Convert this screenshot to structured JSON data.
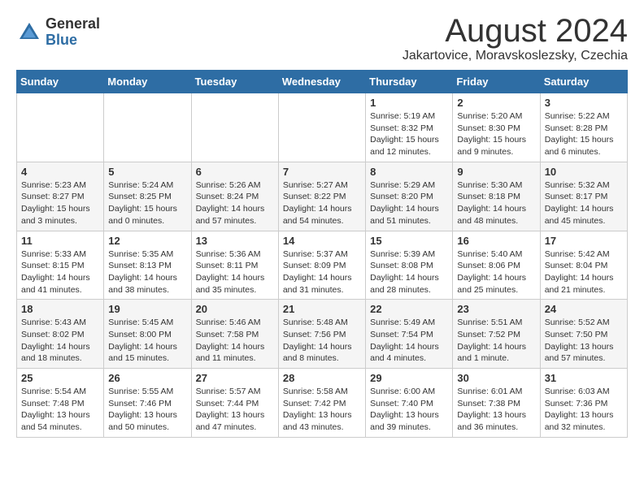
{
  "header": {
    "logo_general": "General",
    "logo_blue": "Blue",
    "month_title": "August 2024",
    "location": "Jakartovice, Moravskoslezsky, Czechia"
  },
  "weekdays": [
    "Sunday",
    "Monday",
    "Tuesday",
    "Wednesday",
    "Thursday",
    "Friday",
    "Saturday"
  ],
  "weeks": [
    [
      {
        "day": "",
        "info": ""
      },
      {
        "day": "",
        "info": ""
      },
      {
        "day": "",
        "info": ""
      },
      {
        "day": "",
        "info": ""
      },
      {
        "day": "1",
        "info": "Sunrise: 5:19 AM\nSunset: 8:32 PM\nDaylight: 15 hours\nand 12 minutes."
      },
      {
        "day": "2",
        "info": "Sunrise: 5:20 AM\nSunset: 8:30 PM\nDaylight: 15 hours\nand 9 minutes."
      },
      {
        "day": "3",
        "info": "Sunrise: 5:22 AM\nSunset: 8:28 PM\nDaylight: 15 hours\nand 6 minutes."
      }
    ],
    [
      {
        "day": "4",
        "info": "Sunrise: 5:23 AM\nSunset: 8:27 PM\nDaylight: 15 hours\nand 3 minutes."
      },
      {
        "day": "5",
        "info": "Sunrise: 5:24 AM\nSunset: 8:25 PM\nDaylight: 15 hours\nand 0 minutes."
      },
      {
        "day": "6",
        "info": "Sunrise: 5:26 AM\nSunset: 8:24 PM\nDaylight: 14 hours\nand 57 minutes."
      },
      {
        "day": "7",
        "info": "Sunrise: 5:27 AM\nSunset: 8:22 PM\nDaylight: 14 hours\nand 54 minutes."
      },
      {
        "day": "8",
        "info": "Sunrise: 5:29 AM\nSunset: 8:20 PM\nDaylight: 14 hours\nand 51 minutes."
      },
      {
        "day": "9",
        "info": "Sunrise: 5:30 AM\nSunset: 8:18 PM\nDaylight: 14 hours\nand 48 minutes."
      },
      {
        "day": "10",
        "info": "Sunrise: 5:32 AM\nSunset: 8:17 PM\nDaylight: 14 hours\nand 45 minutes."
      }
    ],
    [
      {
        "day": "11",
        "info": "Sunrise: 5:33 AM\nSunset: 8:15 PM\nDaylight: 14 hours\nand 41 minutes."
      },
      {
        "day": "12",
        "info": "Sunrise: 5:35 AM\nSunset: 8:13 PM\nDaylight: 14 hours\nand 38 minutes."
      },
      {
        "day": "13",
        "info": "Sunrise: 5:36 AM\nSunset: 8:11 PM\nDaylight: 14 hours\nand 35 minutes."
      },
      {
        "day": "14",
        "info": "Sunrise: 5:37 AM\nSunset: 8:09 PM\nDaylight: 14 hours\nand 31 minutes."
      },
      {
        "day": "15",
        "info": "Sunrise: 5:39 AM\nSunset: 8:08 PM\nDaylight: 14 hours\nand 28 minutes."
      },
      {
        "day": "16",
        "info": "Sunrise: 5:40 AM\nSunset: 8:06 PM\nDaylight: 14 hours\nand 25 minutes."
      },
      {
        "day": "17",
        "info": "Sunrise: 5:42 AM\nSunset: 8:04 PM\nDaylight: 14 hours\nand 21 minutes."
      }
    ],
    [
      {
        "day": "18",
        "info": "Sunrise: 5:43 AM\nSunset: 8:02 PM\nDaylight: 14 hours\nand 18 minutes."
      },
      {
        "day": "19",
        "info": "Sunrise: 5:45 AM\nSunset: 8:00 PM\nDaylight: 14 hours\nand 15 minutes."
      },
      {
        "day": "20",
        "info": "Sunrise: 5:46 AM\nSunset: 7:58 PM\nDaylight: 14 hours\nand 11 minutes."
      },
      {
        "day": "21",
        "info": "Sunrise: 5:48 AM\nSunset: 7:56 PM\nDaylight: 14 hours\nand 8 minutes."
      },
      {
        "day": "22",
        "info": "Sunrise: 5:49 AM\nSunset: 7:54 PM\nDaylight: 14 hours\nand 4 minutes."
      },
      {
        "day": "23",
        "info": "Sunrise: 5:51 AM\nSunset: 7:52 PM\nDaylight: 14 hours\nand 1 minute."
      },
      {
        "day": "24",
        "info": "Sunrise: 5:52 AM\nSunset: 7:50 PM\nDaylight: 13 hours\nand 57 minutes."
      }
    ],
    [
      {
        "day": "25",
        "info": "Sunrise: 5:54 AM\nSunset: 7:48 PM\nDaylight: 13 hours\nand 54 minutes."
      },
      {
        "day": "26",
        "info": "Sunrise: 5:55 AM\nSunset: 7:46 PM\nDaylight: 13 hours\nand 50 minutes."
      },
      {
        "day": "27",
        "info": "Sunrise: 5:57 AM\nSunset: 7:44 PM\nDaylight: 13 hours\nand 47 minutes."
      },
      {
        "day": "28",
        "info": "Sunrise: 5:58 AM\nSunset: 7:42 PM\nDaylight: 13 hours\nand 43 minutes."
      },
      {
        "day": "29",
        "info": "Sunrise: 6:00 AM\nSunset: 7:40 PM\nDaylight: 13 hours\nand 39 minutes."
      },
      {
        "day": "30",
        "info": "Sunrise: 6:01 AM\nSunset: 7:38 PM\nDaylight: 13 hours\nand 36 minutes."
      },
      {
        "day": "31",
        "info": "Sunrise: 6:03 AM\nSunset: 7:36 PM\nDaylight: 13 hours\nand 32 minutes."
      }
    ]
  ]
}
